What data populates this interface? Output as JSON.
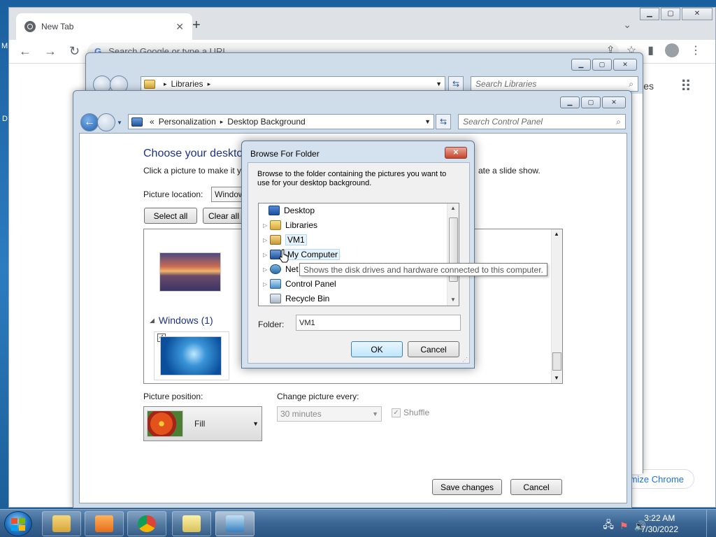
{
  "desktop": {
    "edge_left_top": "M",
    "edge_left_mid": "D"
  },
  "chrome": {
    "tab_title": "New Tab",
    "tab_close": "✕",
    "new_tab": "+",
    "collapse": "⌄",
    "omnibox_placeholder": "Search Google or type a URL",
    "omnibox_g": "G",
    "images_link": "ges",
    "customize_label": "mize Chrome",
    "win_min": "▁",
    "win_max": "▢",
    "win_close": "✕"
  },
  "libraries_window": {
    "address": "Libraries",
    "search_placeholder": "Search Libraries"
  },
  "bg_window": {
    "breadcrumb_prefix": "«",
    "breadcrumb": [
      "Personalization",
      "Desktop Background"
    ],
    "search_placeholder": "Search Control Panel",
    "title": "Choose your desktop",
    "subtitle": "Click a picture to make it y",
    "subtitle_tail": "ate a slide show.",
    "picture_location_label": "Picture location:",
    "picture_location_value": "Window",
    "select_all": "Select all",
    "clear_all": "Clear all",
    "group_label": "Windows (1)",
    "picture_position_label": "Picture position:",
    "picture_position_value": "Fill",
    "change_every_label": "Change picture every:",
    "change_every_value": "30 minutes",
    "shuffle_label": "Shuffle",
    "save_changes": "Save changes",
    "cancel": "Cancel"
  },
  "browse_dialog": {
    "title": "Browse For Folder",
    "description": "Browse to the folder containing the pictures you want to use for your desktop background.",
    "tree": [
      {
        "label": "Desktop",
        "icon": "desktop-icon",
        "expandable": false
      },
      {
        "label": "Libraries",
        "icon": "libraries-icon",
        "expandable": true
      },
      {
        "label": "VM1",
        "icon": "user-folder-icon",
        "expandable": true
      },
      {
        "label": "My Computer",
        "icon": "computer-icon",
        "expandable": true
      },
      {
        "label": "Network",
        "icon": "network-icon",
        "expandable": true
      },
      {
        "label": "Control Panel",
        "icon": "control-panel-icon",
        "expandable": true
      },
      {
        "label": "Recycle Bin",
        "icon": "recycle-bin-icon",
        "expandable": false
      }
    ],
    "tree_row4_visible": "Net",
    "folder_label": "Folder:",
    "folder_value": "VM1",
    "ok": "OK",
    "cancel": "Cancel",
    "tooltip": "Shows the disk drives and hardware connected to this computer."
  },
  "taskbar": {
    "time": "3:22 AM",
    "date": "7/30/2022",
    "apps": [
      "explorer",
      "media-player",
      "chrome",
      "libraries",
      "control-panel"
    ]
  }
}
